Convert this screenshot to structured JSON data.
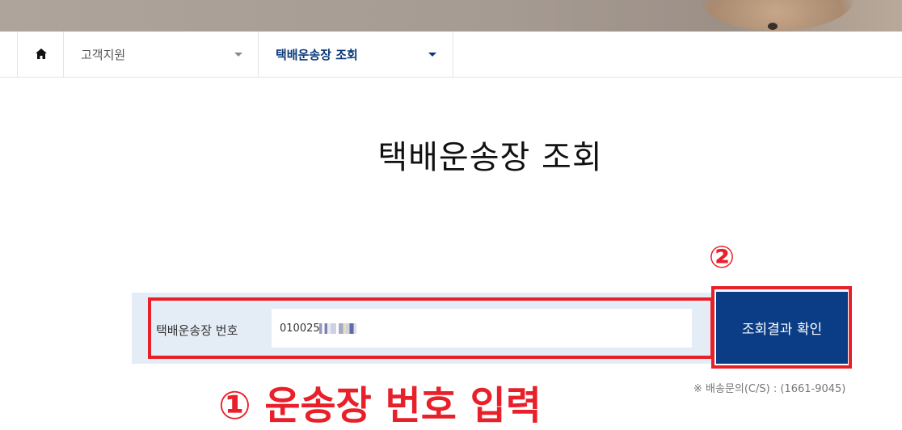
{
  "nav": {
    "home_icon": "home-icon",
    "customer_support_label": "고객지원",
    "tracking_label": "택배운송장 조회"
  },
  "page": {
    "title": "택배운송장 조회"
  },
  "form": {
    "field_label": "택배운송장 번호",
    "tracking_value": "010025",
    "submit_label": "조회결과 확인",
    "cs_note": "※ 배송문의(C/S) : (1661-9045)"
  },
  "annotations": {
    "step1": "① 운송장 번호 입력",
    "step2": "②"
  },
  "colors": {
    "accent_navy": "#0b3d86",
    "annotation_red": "#e8202a",
    "panel_bg": "#e4ecf6"
  }
}
